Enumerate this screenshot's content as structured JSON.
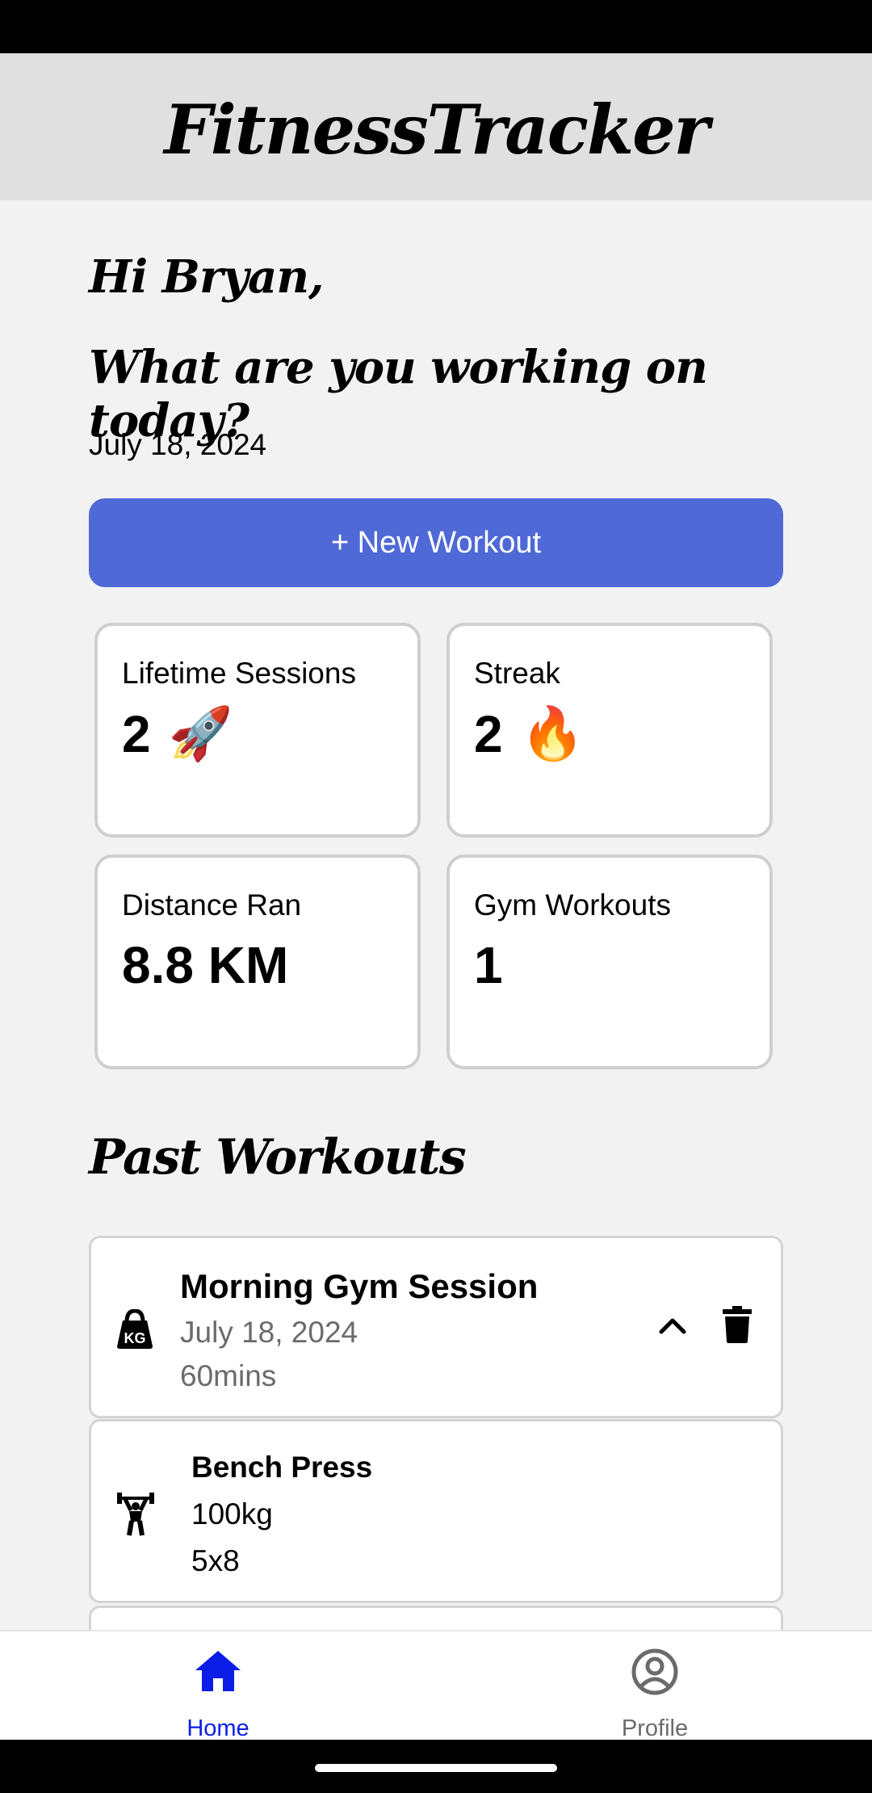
{
  "app": {
    "title": "FitnessTracker"
  },
  "greeting": {
    "line1": "Hi Bryan,",
    "line2": "What are you working on today?",
    "date": "July 18, 2024"
  },
  "actions": {
    "new_workout_label": "+ New Workout"
  },
  "stats": [
    {
      "label": "Lifetime Sessions",
      "value": "2",
      "emoji": "🚀"
    },
    {
      "label": "Streak",
      "value": "2",
      "emoji": "🔥"
    },
    {
      "label": "Distance Ran",
      "value": "8.8 KM",
      "emoji": ""
    },
    {
      "label": "Gym Workouts",
      "value": "1",
      "emoji": ""
    }
  ],
  "past_workouts": {
    "title": "Past Workouts",
    "items": [
      {
        "title": "Morning Gym Session",
        "date": "July 18, 2024",
        "duration": "60mins",
        "icon": "kettlebell-icon",
        "exercises": [
          {
            "name": "Bench Press",
            "weight": "100kg",
            "reps": "5x8",
            "icon": "weightlifter-icon"
          }
        ]
      }
    ]
  },
  "nav": {
    "items": [
      {
        "label": "Home",
        "icon": "home-icon",
        "active": true
      },
      {
        "label": "Profile",
        "icon": "profile-icon",
        "active": false
      }
    ]
  },
  "colors": {
    "accent": "#4f6ad6",
    "nav_active": "#0a1ee8",
    "nav_inactive": "#6b6b6b"
  }
}
